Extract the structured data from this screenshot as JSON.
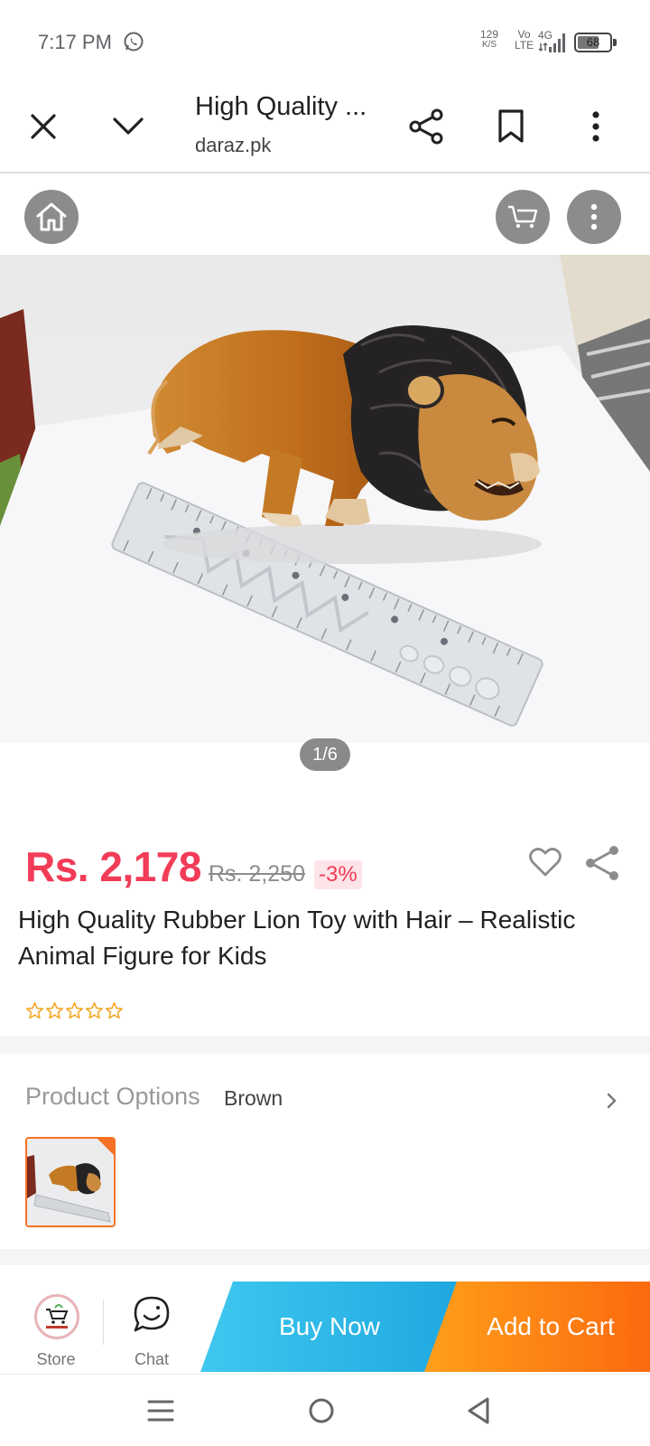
{
  "status_bar": {
    "time": "7:17 PM",
    "net_speed_value": "129",
    "net_speed_unit": "K/S",
    "volte_top": "Vo",
    "volte_bottom": "LTE",
    "network": "4G",
    "battery": "68"
  },
  "toolbar": {
    "page_title": "High Quality ...",
    "url": "daraz.pk"
  },
  "gallery": {
    "counter": "1/6"
  },
  "product": {
    "price": "Rs. 2,178",
    "original_price": "Rs. 2,250",
    "discount": "-3%",
    "title": "High Quality Rubber Lion Toy with Hair – Realistic Animal Figure for Kids",
    "rating_stars": 0,
    "rating_max": 5
  },
  "options": {
    "label": "Product Options",
    "selected": "Brown"
  },
  "bottom_bar": {
    "store_label": "Store",
    "chat_label": "Chat",
    "buy_now": "Buy Now",
    "add_to_cart": "Add to Cart"
  },
  "colors": {
    "price": "#f23c57",
    "buy_now": "#1fa8e0",
    "add_to_cart": "#fb6a0f",
    "selected_option_border": "#f57224",
    "star": "#f5a623"
  }
}
